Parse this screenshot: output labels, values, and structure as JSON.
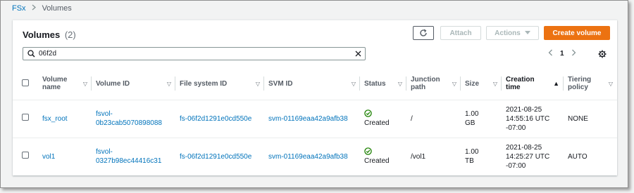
{
  "breadcrumb": {
    "root": "FSx",
    "current": "Volumes"
  },
  "panel": {
    "title": "Volumes",
    "count": "(2)",
    "buttons": {
      "attach": "Attach",
      "actions": "Actions",
      "create": "Create volume"
    }
  },
  "search": {
    "value": "06f2d"
  },
  "pagination": {
    "current_page": "1"
  },
  "table": {
    "headers": {
      "volume_name": "Volume name",
      "volume_id": "Volume ID",
      "fs_id": "File system ID",
      "svm_id": "SVM ID",
      "status": "Status",
      "junction": "Junction path",
      "size": "Size",
      "creation": "Creation time",
      "tiering": "Tiering policy"
    },
    "rows": [
      {
        "name": "fsx_root",
        "volume_id_1": "fsvol-",
        "volume_id_2": "0b23cab5070898088",
        "fs_id": "fs-06f2d1291e0cd550e",
        "svm_id": "svm-01169eaa42a9afb38",
        "status": "Created",
        "junction": "/",
        "size_1": "1.00",
        "size_2": "GB",
        "created_1": "2021-08-25",
        "created_2": "14:55:16 UTC",
        "created_3": "-07:00",
        "tiering": "NONE"
      },
      {
        "name": "vol1",
        "volume_id_1": "fsvol-",
        "volume_id_2": "0327b98ec44416c31",
        "fs_id": "fs-06f2d1291e0cd550e",
        "svm_id": "svm-01169eaa42a9afb38",
        "status": "Created",
        "junction": "/vol1",
        "size_1": "1.00",
        "size_2": "TB",
        "created_1": "2021-08-25",
        "created_2": "14:25:27 UTC",
        "created_3": "-07:00",
        "tiering": "AUTO"
      }
    ]
  },
  "colors": {
    "link": "#0073bb",
    "primary": "#ec7211",
    "success": "#1d8102"
  },
  "icons": [
    "chevron-right-icon",
    "refresh-icon",
    "caret-down-icon",
    "search-icon",
    "close-icon",
    "chevron-left-icon",
    "gear-icon",
    "success-icon",
    "sort-ascending-icon"
  ]
}
